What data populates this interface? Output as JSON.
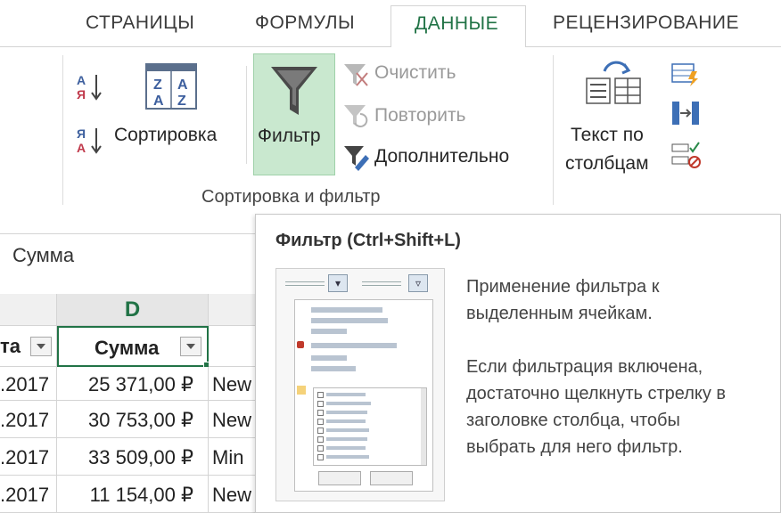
{
  "tabs": {
    "pages": "СТРАНИЦЫ",
    "formulas": "ФОРМУЛЫ",
    "data": "ДАННЫЕ",
    "review": "РЕЦЕНЗИРОВАНИЕ"
  },
  "ribbon": {
    "sort_az_icon": "sort-ascending-icon",
    "sort_za_icon": "sort-descending-icon",
    "sort_label": "Сортировка",
    "filter_label": "Фильтр",
    "clear_label": "Очистить",
    "reapply_label": "Повторить",
    "advanced_label": "Дополнительно",
    "group_label": "Сортировка и фильтр",
    "text_to_columns_line1": "Текст по",
    "text_to_columns_line2": "столбцам",
    "sort_az_letters": [
      "А",
      "Я"
    ],
    "sort_za_letters": [
      "Я",
      "А"
    ],
    "sort_box_letters": [
      "Z",
      "A",
      "A",
      "Z"
    ]
  },
  "formula_bar": {
    "value": "Сумма"
  },
  "sheet": {
    "column_letter": "D",
    "headers": [
      "та",
      "Сумма"
    ],
    "rows": [
      {
        "date": ".2017",
        "amount": "25 371,00 ₽",
        "extra": "New"
      },
      {
        "date": ".2017",
        "amount": "30 753,00 ₽",
        "extra": "New"
      },
      {
        "date": ".2017",
        "amount": "33 509,00 ₽",
        "extra": "Min"
      },
      {
        "date": ".2017",
        "amount": "11 154,00 ₽",
        "extra": "New"
      }
    ]
  },
  "tooltip": {
    "title": "Фильтр (Ctrl+Shift+L)",
    "text1_line1": "Применение фильтра к",
    "text1_line2": "выделенным ячейкам.",
    "text2_line1": "Если фильтрация включена,",
    "text2_line2": "достаточно щелкнуть стрелку в",
    "text2_line3": "заголовке столбца, чтобы",
    "text2_line4": "выбрать для него фильтр."
  },
  "colors": {
    "accent_green": "#217346",
    "filter_button_bg": "#c9e8cf",
    "selected_cell_border": "#217346"
  }
}
